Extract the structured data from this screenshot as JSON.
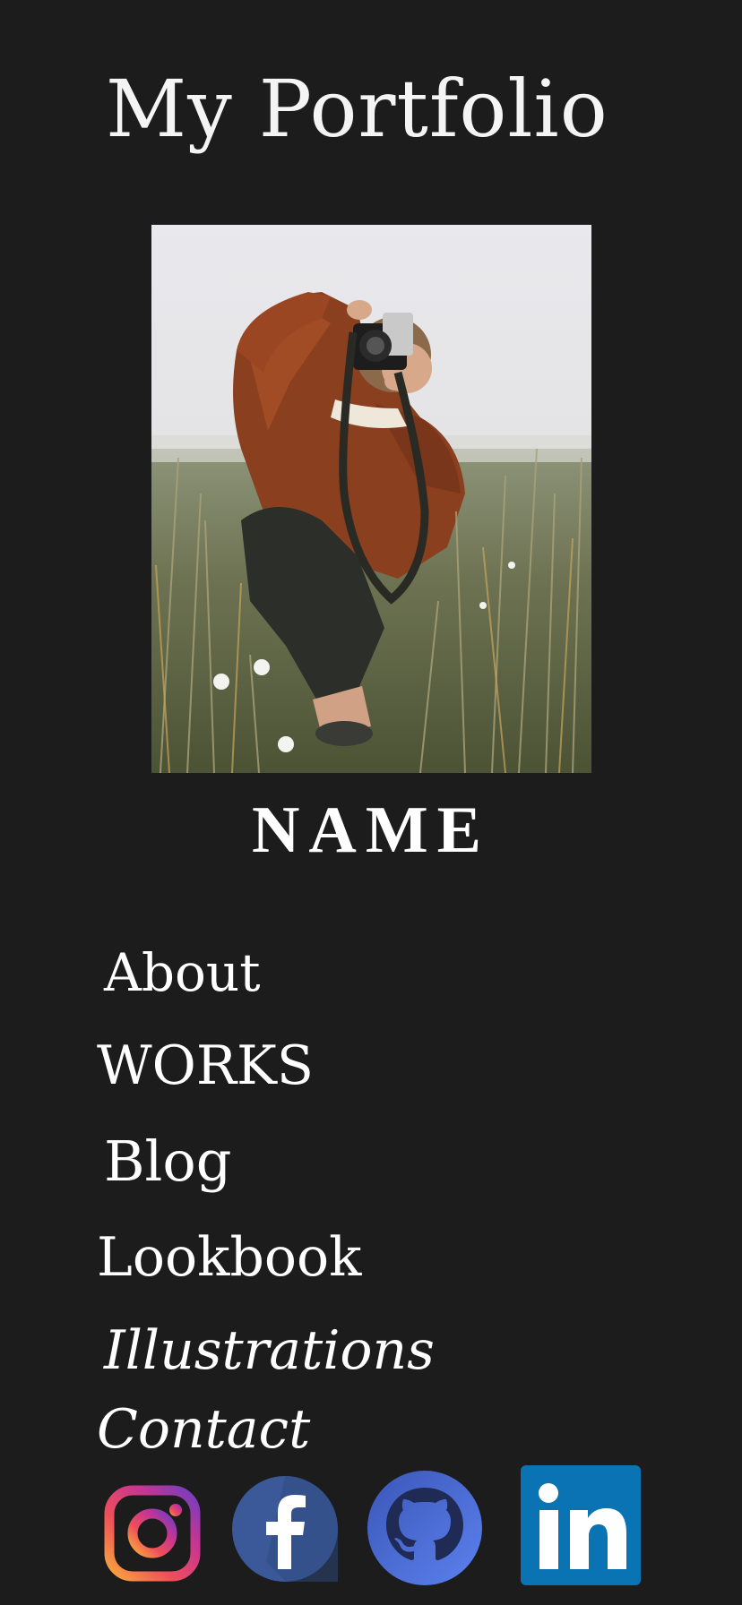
{
  "header": {
    "title": "My Portfolio"
  },
  "profile": {
    "photo_icon": "photographer-with-camera-image",
    "name": "NAME"
  },
  "nav": {
    "items": [
      {
        "label": "About"
      },
      {
        "label": "WORKS"
      },
      {
        "label": "Blog"
      },
      {
        "label": "Lookbook"
      },
      {
        "label": "Illustrations"
      },
      {
        "label": "Contact"
      }
    ]
  },
  "social": {
    "icons": [
      "instagram-icon",
      "facebook-icon",
      "github-icon",
      "linkedin-icon"
    ]
  },
  "colors": {
    "background": "#1c1c1c",
    "text": "#ffffff",
    "facebook": "#3b5998",
    "github": "#4a6fd8",
    "linkedin": "#0a73b3"
  }
}
